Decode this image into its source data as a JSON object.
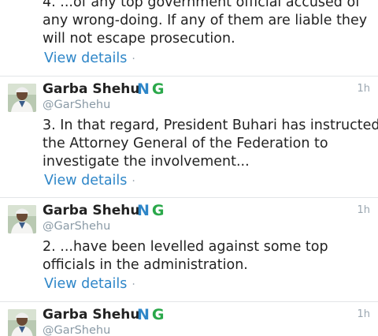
{
  "tweets": [
    {
      "text_lines": [
        "4. ...of any top government official accused of",
        "any wrong-doing. If any of them are liable they",
        "will not escape prosecution."
      ],
      "details_label": "View details",
      "separator": "·"
    },
    {
      "author": "Garba Shehu",
      "flag_left": "N",
      "flag_right": "G",
      "handle": "@GarShehu",
      "time": "1h",
      "text_lines": [
        "3. In that regard, President Buhari has instructed",
        "the Attorney General of the Federation to",
        "investigate the involvement..."
      ],
      "details_label": "View details",
      "separator": "·"
    },
    {
      "author": "Garba Shehu",
      "flag_left": "N",
      "flag_right": "G",
      "handle": "@GarShehu",
      "time": "1h",
      "text_lines": [
        "2. ...have been levelled against some top",
        "officials in the administration."
      ],
      "details_label": "View details",
      "separator": "·"
    },
    {
      "author": "Garba Shehu",
      "flag_left": "N",
      "flag_right": "G",
      "handle": "@GarShehu",
      "time": "1h"
    }
  ],
  "colors": {
    "link": "#2e86c8",
    "flag_green": "#2aa84a",
    "handle": "#8a9aa6",
    "divider": "#e3e5e8"
  },
  "icons": {
    "avatar": "profile-photo"
  }
}
